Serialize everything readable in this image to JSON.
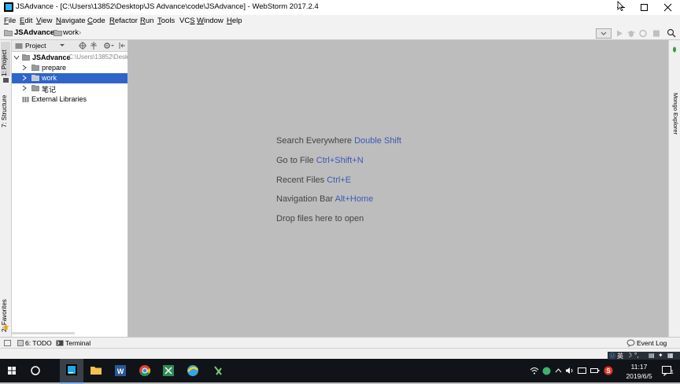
{
  "window": {
    "title": "JSAdvance - [C:\\Users\\13852\\Desktop\\JS Advance\\code\\JSAdvance] - WebStorm 2017.2.4"
  },
  "menu": {
    "items": [
      {
        "mnemonic": "F",
        "rest": "ile"
      },
      {
        "mnemonic": "E",
        "rest": "dit"
      },
      {
        "mnemonic": "V",
        "rest": "iew"
      },
      {
        "mnemonic": "N",
        "rest": "avigate"
      },
      {
        "mnemonic": "C",
        "rest": "ode"
      },
      {
        "mnemonic": "R",
        "rest": "efactor"
      },
      {
        "mnemonic": "R",
        "rest": "un",
        "pre": ""
      },
      {
        "mnemonic": "T",
        "rest": "ools"
      },
      {
        "pre": "VC",
        "mnemonic": "S",
        "rest": ""
      },
      {
        "mnemonic": "W",
        "rest": "indow"
      },
      {
        "mnemonic": "H",
        "rest": "elp"
      }
    ]
  },
  "breadcrumb": {
    "root": "JSAdvance",
    "child": "work"
  },
  "left_tabs": {
    "project": "1: Project",
    "structure": "7: Structure",
    "favorites": "2: Favorites"
  },
  "project_panel": {
    "header_label": "Project",
    "root_name": "JSAdvance",
    "root_path": "C:\\Users\\13852\\Desk",
    "children": [
      "prepare",
      "work",
      "笔记"
    ],
    "external": "External Libraries"
  },
  "editor_hints": [
    {
      "text": "Search Everywhere",
      "shortcut": "Double Shift"
    },
    {
      "text": "Go to File",
      "shortcut": "Ctrl+Shift+N"
    },
    {
      "text": "Recent Files",
      "shortcut": "Ctrl+E"
    },
    {
      "text": "Navigation Bar",
      "shortcut": "Alt+Home"
    },
    {
      "text": "Drop files here to open",
      "shortcut": ""
    }
  ],
  "right_tabs": {
    "mongo": "Mongo Explorer"
  },
  "bottom_bar": {
    "todo": "6: TODO",
    "terminal": "Terminal",
    "event_log": "Event Log"
  },
  "taskbar": {
    "time": "11:17",
    "date": "2019/6/5",
    "ime": "英",
    "notifications": "1"
  },
  "colors": {
    "selection": "#2f65ca",
    "shortcut": "#3c59b5",
    "editor_bg": "#bdbdbd"
  }
}
